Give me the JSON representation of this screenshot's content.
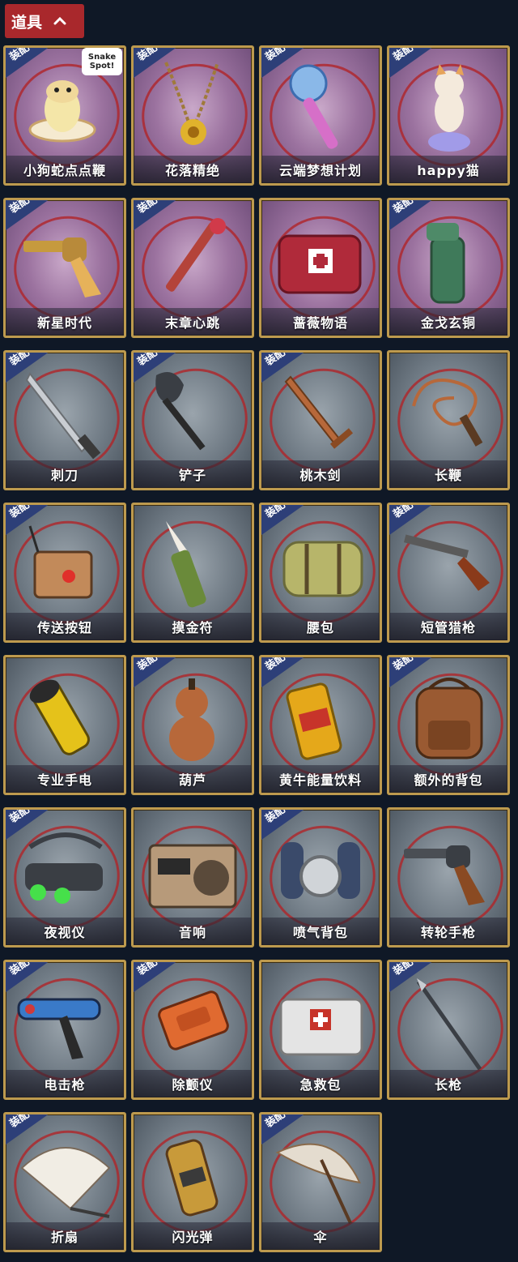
{
  "header": {
    "label": "道具"
  },
  "badge_text": "装配",
  "items": [
    {
      "name": "小狗蛇点点鞭",
      "frame": "purple",
      "equipped": true,
      "icon": "snake-whip-icon",
      "logo": "Snake Spot!"
    },
    {
      "name": "花落精绝",
      "frame": "purple",
      "equipped": true,
      "icon": "flower-necklace-icon"
    },
    {
      "name": "云端梦想计划",
      "frame": "purple",
      "equipped": true,
      "icon": "dream-mace-icon"
    },
    {
      "name": "happy猫",
      "frame": "purple",
      "equipped": true,
      "icon": "cat-figurine-icon"
    },
    {
      "name": "新星时代",
      "frame": "purple",
      "equipped": true,
      "icon": "revolver-gold-icon"
    },
    {
      "name": "末章心跳",
      "frame": "purple",
      "equipped": true,
      "icon": "heart-syringe-icon"
    },
    {
      "name": "蔷薇物语",
      "frame": "purple",
      "equipped": false,
      "icon": "rose-medkit-icon"
    },
    {
      "name": "金戈玄铜",
      "frame": "purple",
      "equipped": true,
      "icon": "bronze-grenade-icon"
    },
    {
      "name": "刺刀",
      "frame": "gray",
      "equipped": true,
      "icon": "bayonet-icon"
    },
    {
      "name": "铲子",
      "frame": "gray",
      "equipped": true,
      "icon": "shovel-icon"
    },
    {
      "name": "桃木剑",
      "frame": "gray",
      "equipped": true,
      "icon": "wooden-sword-icon"
    },
    {
      "name": "长鞭",
      "frame": "gray",
      "equipped": false,
      "icon": "whip-icon"
    },
    {
      "name": "传送按钮",
      "frame": "gray",
      "equipped": true,
      "icon": "teleport-button-icon"
    },
    {
      "name": "摸金符",
      "frame": "gray",
      "equipped": false,
      "icon": "talisman-icon"
    },
    {
      "name": "腰包",
      "frame": "gray",
      "equipped": true,
      "icon": "waist-bag-icon"
    },
    {
      "name": "短管猎枪",
      "frame": "gray",
      "equipped": true,
      "icon": "shotgun-icon"
    },
    {
      "name": "专业手电",
      "frame": "gray",
      "equipped": false,
      "icon": "flashlight-icon"
    },
    {
      "name": "葫芦",
      "frame": "gray",
      "equipped": true,
      "icon": "gourd-icon"
    },
    {
      "name": "黄牛能量饮料",
      "frame": "gray",
      "equipped": true,
      "icon": "energy-drink-icon"
    },
    {
      "name": "额外的背包",
      "frame": "gray",
      "equipped": true,
      "icon": "backpack-icon"
    },
    {
      "name": "夜视仪",
      "frame": "gray",
      "equipped": true,
      "icon": "night-vision-icon"
    },
    {
      "name": "音响",
      "frame": "gray",
      "equipped": false,
      "icon": "radio-speaker-icon"
    },
    {
      "name": "喷气背包",
      "frame": "gray",
      "equipped": true,
      "icon": "jetpack-icon"
    },
    {
      "name": "转轮手枪",
      "frame": "gray",
      "equipped": false,
      "icon": "revolver-icon"
    },
    {
      "name": "电击枪",
      "frame": "gray",
      "equipped": true,
      "icon": "taser-gun-icon"
    },
    {
      "name": "除颤仪",
      "frame": "gray",
      "equipped": true,
      "icon": "defibrillator-icon"
    },
    {
      "name": "急救包",
      "frame": "gray",
      "equipped": false,
      "icon": "first-aid-kit-icon"
    },
    {
      "name": "长枪",
      "frame": "gray",
      "equipped": true,
      "icon": "spear-icon"
    },
    {
      "name": "折扇",
      "frame": "gray",
      "equipped": true,
      "icon": "folding-fan-icon"
    },
    {
      "name": "闪光弹",
      "frame": "gray",
      "equipped": false,
      "icon": "flashbang-icon"
    },
    {
      "name": "伞",
      "frame": "gray",
      "equipped": true,
      "icon": "umbrella-icon"
    }
  ],
  "colors": {
    "background": "#0f1826",
    "header": "#a9282c",
    "frame_gold": "#bd9a4e",
    "badge": "#2d3f78",
    "ring": "#b02428"
  }
}
